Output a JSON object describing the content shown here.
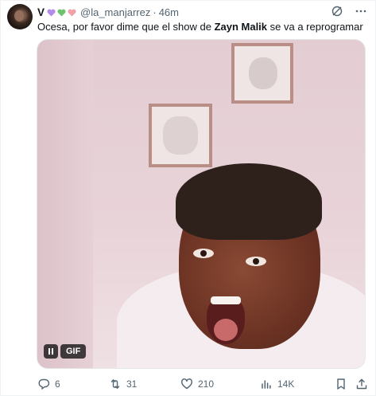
{
  "tweet": {
    "display_name": "V",
    "handle": "@la_manjarrez",
    "separator": "·",
    "time": "46m",
    "text_before": "Ocesa, por favor dime que el show de ",
    "text_bold": "Zayn Malik",
    "text_after": " se va a reprogramar"
  },
  "name_hearts": [
    "#b48be6",
    "#6dc46d",
    "#f2a0aa"
  ],
  "media": {
    "type": "gif",
    "gif_label": "GIF",
    "pause_icon": "pause-icon"
  },
  "actions": {
    "reply_count": "6",
    "retweet_count": "31",
    "like_count": "210",
    "views_count": "14K"
  },
  "colors": {
    "text": "#0f1419",
    "muted": "#536471",
    "border": "#eff3f4"
  }
}
